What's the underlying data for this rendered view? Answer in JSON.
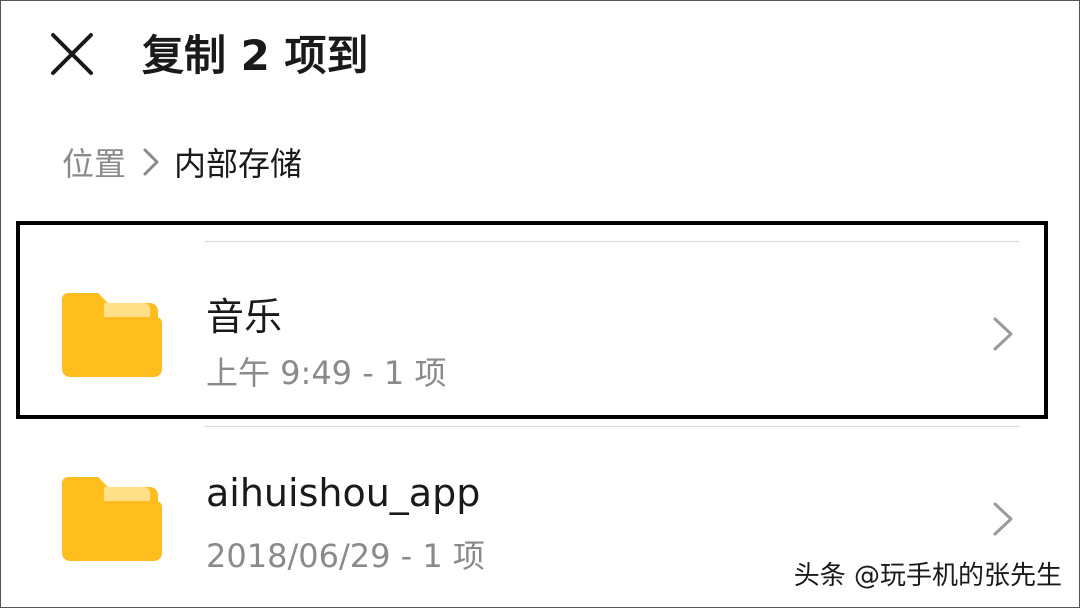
{
  "header": {
    "close_icon": "close-icon",
    "title": "复制 2 项到"
  },
  "breadcrumb": {
    "root": "位置",
    "separator_icon": "chevron-right-icon",
    "current": "内部存储"
  },
  "folders": [
    {
      "icon": "folder-icon",
      "name": "音乐",
      "meta": "上午 9:49  - 1 项",
      "highlighted": true
    },
    {
      "icon": "folder-icon",
      "name": "aihuishou_app",
      "meta": "2018/06/29 - 1 项",
      "highlighted": false
    }
  ],
  "colors": {
    "folder": "#FFBE1E",
    "folder_tab_light": "#FFE089",
    "secondary_text": "#8a8a8a",
    "divider": "#d9d9d9"
  },
  "watermark": "头条 @玩手机的张先生"
}
